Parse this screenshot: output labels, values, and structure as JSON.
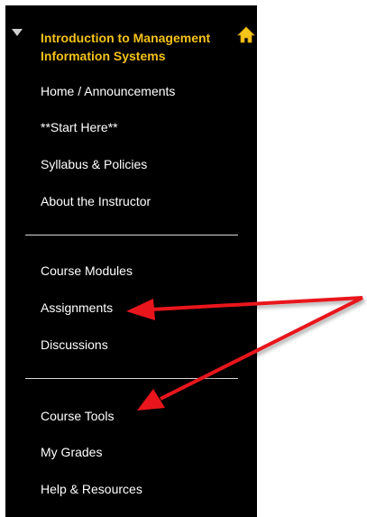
{
  "course": {
    "title_line1": "Introduction to Management",
    "title_line2": "Information Systems"
  },
  "nav": {
    "home": "Home / Announcements",
    "start_here": "**Start Here**",
    "syllabus": "Syllabus & Policies",
    "instructor": "About the Instructor",
    "modules": "Course Modules",
    "assignments": "Assignments",
    "discussions": "Discussions",
    "tools": "Course Tools",
    "grades": "My Grades",
    "help": "Help & Resources"
  },
  "icons": {
    "collapse": "triangle-down-icon",
    "home": "home-icon"
  },
  "colors": {
    "menu_background": "#000000",
    "course_title": "#f5c21b",
    "nav_text": "#ffffff",
    "arrow": "#e8141b"
  }
}
